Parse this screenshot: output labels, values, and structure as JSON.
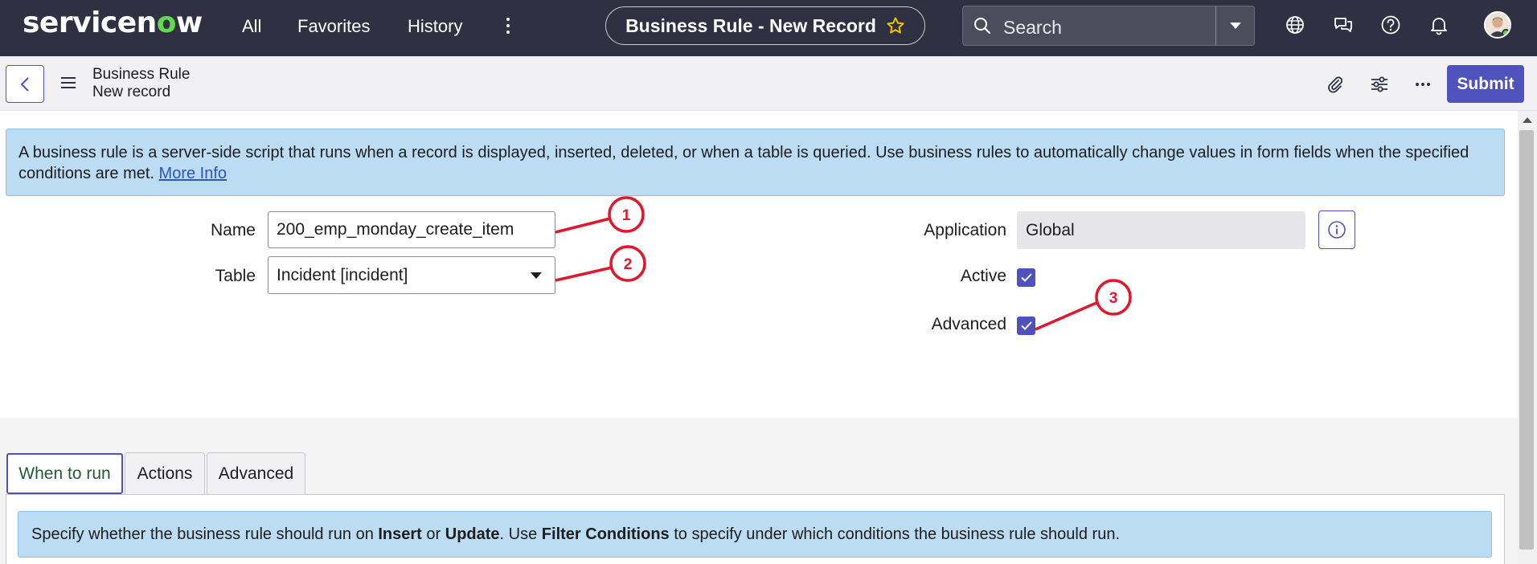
{
  "topnav": {
    "logo_prefix": "servicen",
    "logo_o": "o",
    "logo_suffix": "w",
    "links": [
      "All",
      "Favorites",
      "History"
    ],
    "record_title": "Business Rule - New Record",
    "search_placeholder": "Search",
    "icons": [
      "globe-icon",
      "chat-icon",
      "help-icon",
      "bell-icon"
    ]
  },
  "subheader": {
    "breadcrumb_title": "Business Rule",
    "breadcrumb_sub": "New record",
    "submit_label": "Submit"
  },
  "banner": {
    "text": "A business rule is a server-side script that runs when a record is displayed, inserted, deleted, or when a table is queried. Use business rules to automatically change values in form fields when the specified conditions are met.",
    "link": "More Info"
  },
  "form": {
    "name_label": "Name",
    "name_value": "200_emp_monday_create_item",
    "table_label": "Table",
    "table_value": "Incident [incident]",
    "application_label": "Application",
    "application_value": "Global",
    "active_label": "Active",
    "active_checked": true,
    "advanced_label": "Advanced",
    "advanced_checked": true
  },
  "annotations": [
    "1",
    "2",
    "3"
  ],
  "annotation_color": "#e0182d",
  "tabs": [
    "When to run",
    "Actions",
    "Advanced"
  ],
  "tab_info": {
    "t1": "Specify whether the business rule should run on ",
    "b1": "Insert",
    "t2": " or ",
    "b2": "Update",
    "t3": ". Use ",
    "b3": "Filter Conditions",
    "t4": " to specify under which conditions the business rule should run."
  },
  "colors": {
    "nav_bg": "#2f3142",
    "accent": "#4f52bd",
    "info_bg": "#bcdcf3",
    "logo_green": "#62d84e"
  }
}
